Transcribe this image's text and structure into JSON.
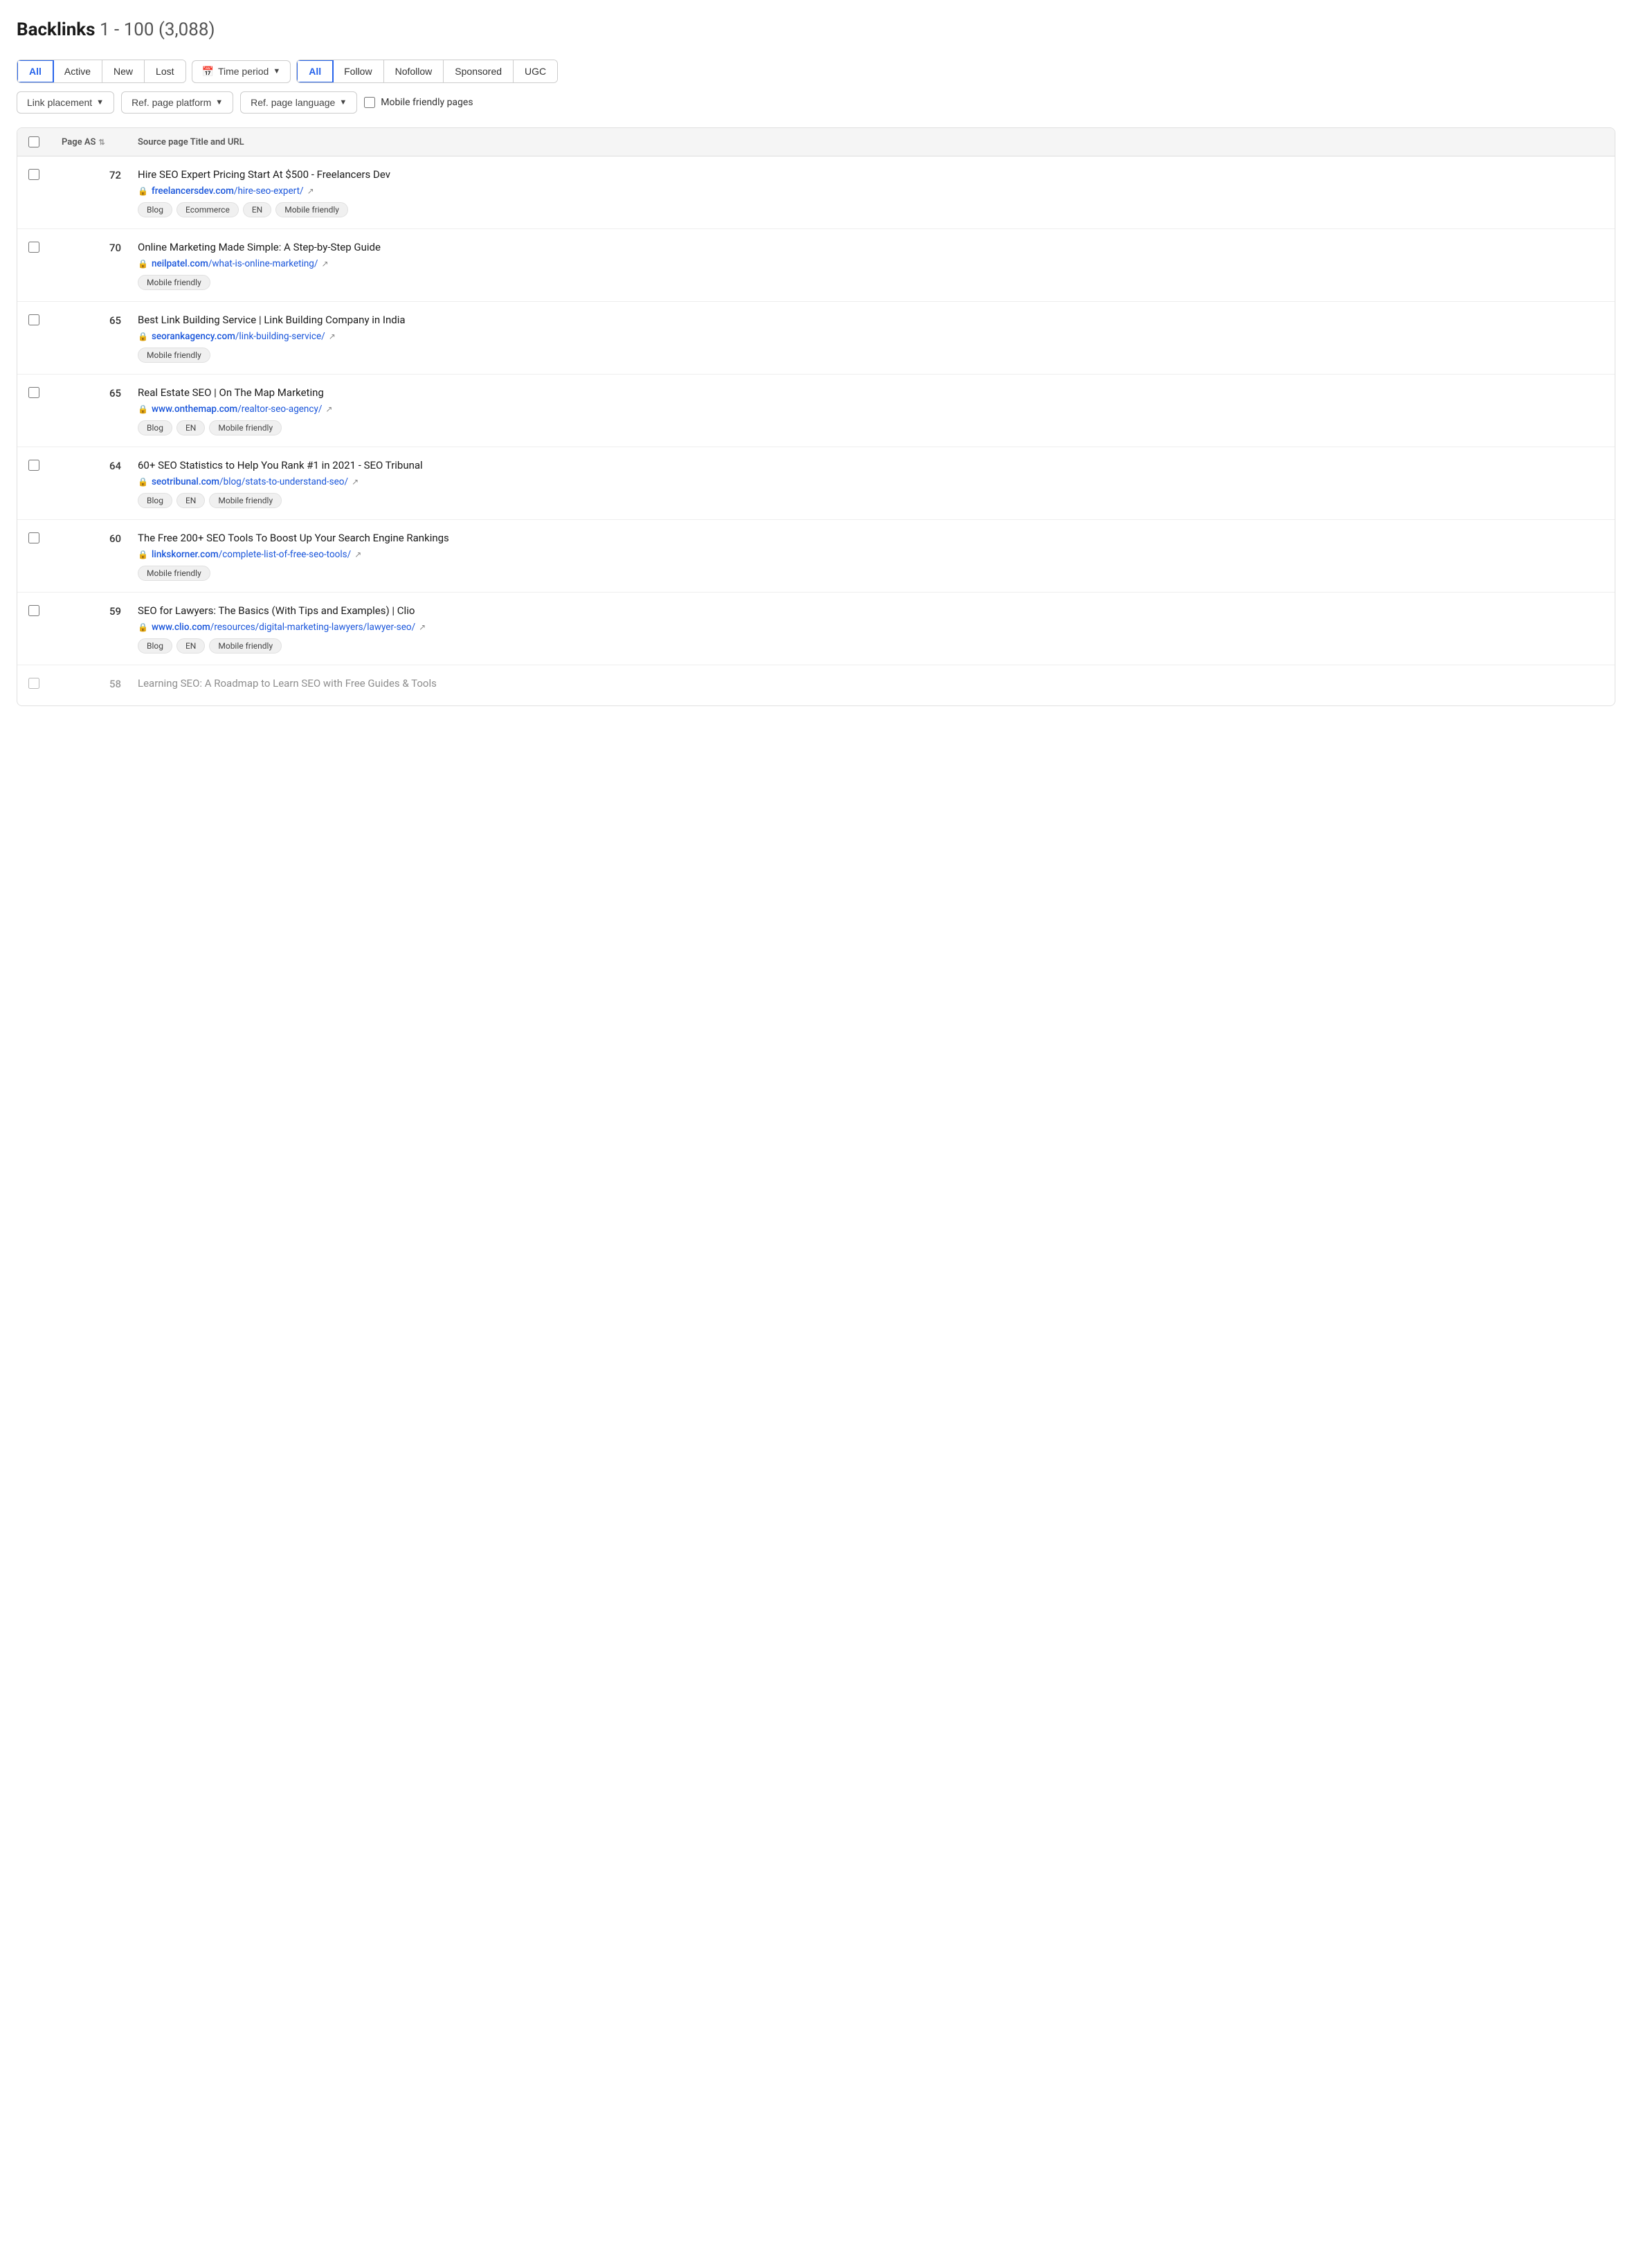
{
  "header": {
    "title": "Backlinks",
    "range": "1 - 100 (3,088)"
  },
  "filters": {
    "status_buttons": [
      {
        "label": "All",
        "active": true
      },
      {
        "label": "Active",
        "active": false
      },
      {
        "label": "New",
        "active": false
      },
      {
        "label": "Lost",
        "active": false
      }
    ],
    "time_period_label": "Time period",
    "link_type_buttons": [
      {
        "label": "All",
        "active": true
      },
      {
        "label": "Follow",
        "active": false
      },
      {
        "label": "Nofollow",
        "active": false
      },
      {
        "label": "Sponsored",
        "active": false
      },
      {
        "label": "UGC",
        "active": false
      }
    ],
    "link_placement_label": "Link placement",
    "ref_page_platform_label": "Ref. page platform",
    "ref_page_language_label": "Ref. page language",
    "mobile_friendly_label": "Mobile friendly pages"
  },
  "table": {
    "col_page_as": "Page AS",
    "col_source": "Source page Title and URL",
    "rows": [
      {
        "as": "72",
        "title": "Hire SEO Expert Pricing Start At $500 - Freelancers Dev",
        "url_base": "freelancersdev.com",
        "url_path": "/hire-seo-expert/",
        "tags": [
          "Blog",
          "Ecommerce",
          "EN",
          "Mobile friendly"
        ],
        "dimmed": false
      },
      {
        "as": "70",
        "title": "Online Marketing Made Simple: A Step-by-Step Guide",
        "url_base": "neilpatel.com",
        "url_path": "/what-is-online-marketing/",
        "tags": [
          "Mobile friendly"
        ],
        "dimmed": false
      },
      {
        "as": "65",
        "title": "Best Link Building Service | Link Building Company in India",
        "url_base": "seorankagency.com",
        "url_path": "/link-building-service/",
        "tags": [
          "Mobile friendly"
        ],
        "dimmed": false
      },
      {
        "as": "65",
        "title": "Real Estate SEO | On The Map Marketing",
        "url_base": "www.onthemap.com",
        "url_path": "/realtor-seo-agency/",
        "tags": [
          "Blog",
          "EN",
          "Mobile friendly"
        ],
        "dimmed": false
      },
      {
        "as": "64",
        "title": "60+ SEO Statistics to Help You Rank #1 in 2021 - SEO Tribunal",
        "url_base": "seotribunal.com",
        "url_path": "/blog/stats-to-understand-seo/",
        "tags": [
          "Blog",
          "EN",
          "Mobile friendly"
        ],
        "dimmed": false
      },
      {
        "as": "60",
        "title": "The Free 200+ SEO Tools To Boost Up Your Search Engine Rankings",
        "url_base": "linkskorner.com",
        "url_path": "/complete-list-of-free-seo-tools/",
        "tags": [
          "Mobile friendly"
        ],
        "dimmed": false
      },
      {
        "as": "59",
        "title": "SEO for Lawyers: The Basics (With Tips and Examples) | Clio",
        "url_base": "www.clio.com",
        "url_path": "/resources/digital-marketing-lawyers/lawyer-seo/",
        "tags": [
          "Blog",
          "EN",
          "Mobile friendly"
        ],
        "dimmed": false
      },
      {
        "as": "58",
        "title": "Learning SEO: A Roadmap to Learn SEO with Free Guides & Tools",
        "url_base": "",
        "url_path": "",
        "tags": [],
        "dimmed": true
      }
    ]
  }
}
